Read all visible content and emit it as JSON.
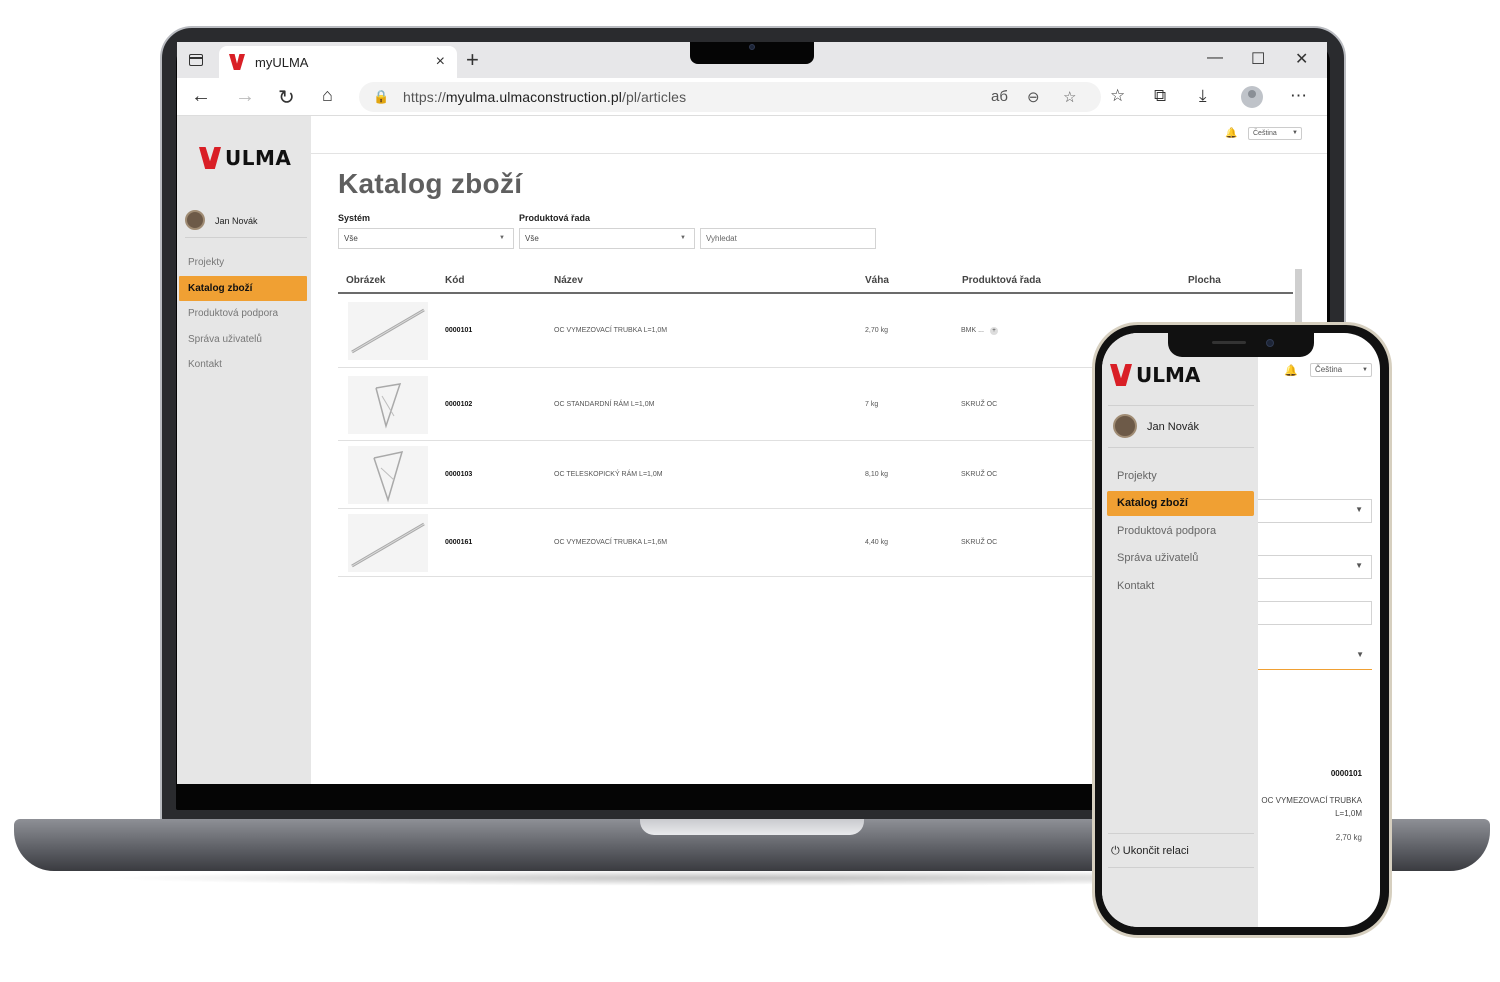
{
  "browser": {
    "tab_title": "myULMA",
    "url_prefix": "https://",
    "url_host": "myulma.ulmaconstruction.pl",
    "url_path": "/pl/articles",
    "new_tab": "+",
    "close_tab": "×"
  },
  "app": {
    "brand": "ULMA",
    "user_name": "Jan Novák",
    "language": "Čeština",
    "menu": [
      {
        "label": "Projekty",
        "active": false
      },
      {
        "label": "Katalog zboží",
        "active": true
      },
      {
        "label": "Produktová podpora",
        "active": false
      },
      {
        "label": "Správa uživatelů",
        "active": false
      },
      {
        "label": "Kontakt",
        "active": false
      }
    ],
    "page_title": "Katalog zboží",
    "filters": {
      "system_label": "Systém",
      "system_value": "Vše",
      "line_label": "Produktová řada",
      "line_value": "Vše",
      "search_placeholder": "Vyhledat"
    },
    "table": {
      "columns": [
        "Obrázek",
        "Kód",
        "Název",
        "Váha",
        "Produktová řada",
        "Plocha"
      ],
      "rows": [
        {
          "code": "0000101",
          "name": "OC VYMEZOVACÍ TRUBKA L=1,0M",
          "weight": "2,70 kg",
          "line": "BMK ..."
        },
        {
          "code": "0000102",
          "name": "OC STANDARDNÍ RÁM L=1,0M",
          "weight": "7 kg",
          "line": "SKRUŽ OC"
        },
        {
          "code": "0000103",
          "name": "OC TELESKOPICKÝ RÁM L=1,0M",
          "weight": "8,10 kg",
          "line": "SKRUŽ OC"
        },
        {
          "code": "0000161",
          "name": "OC VYMEZOVACÍ TRUBKA L=1,6M",
          "weight": "4,40 kg",
          "line": "SKRUŽ OC"
        }
      ]
    }
  },
  "phone": {
    "brand": "ULMA",
    "user_name": "Jan Novák",
    "language": "Čeština",
    "menu": [
      {
        "label": "Projekty",
        "active": false
      },
      {
        "label": "Katalog zboží",
        "active": true
      },
      {
        "label": "Produktová podpora",
        "active": false
      },
      {
        "label": "Správa uživatelů",
        "active": false
      },
      {
        "label": "Kontakt",
        "active": false
      }
    ],
    "logout_label": "Ukončit relaci",
    "item_code": "0000101",
    "item_name": "OC VYMEZOVACÍ TRUBKA L=1,0M",
    "item_weight": "2,70 kg"
  },
  "colors": {
    "accent": "#f0a033",
    "brand_red": "#d91f26",
    "sidebar_bg": "#e6e6e6"
  }
}
